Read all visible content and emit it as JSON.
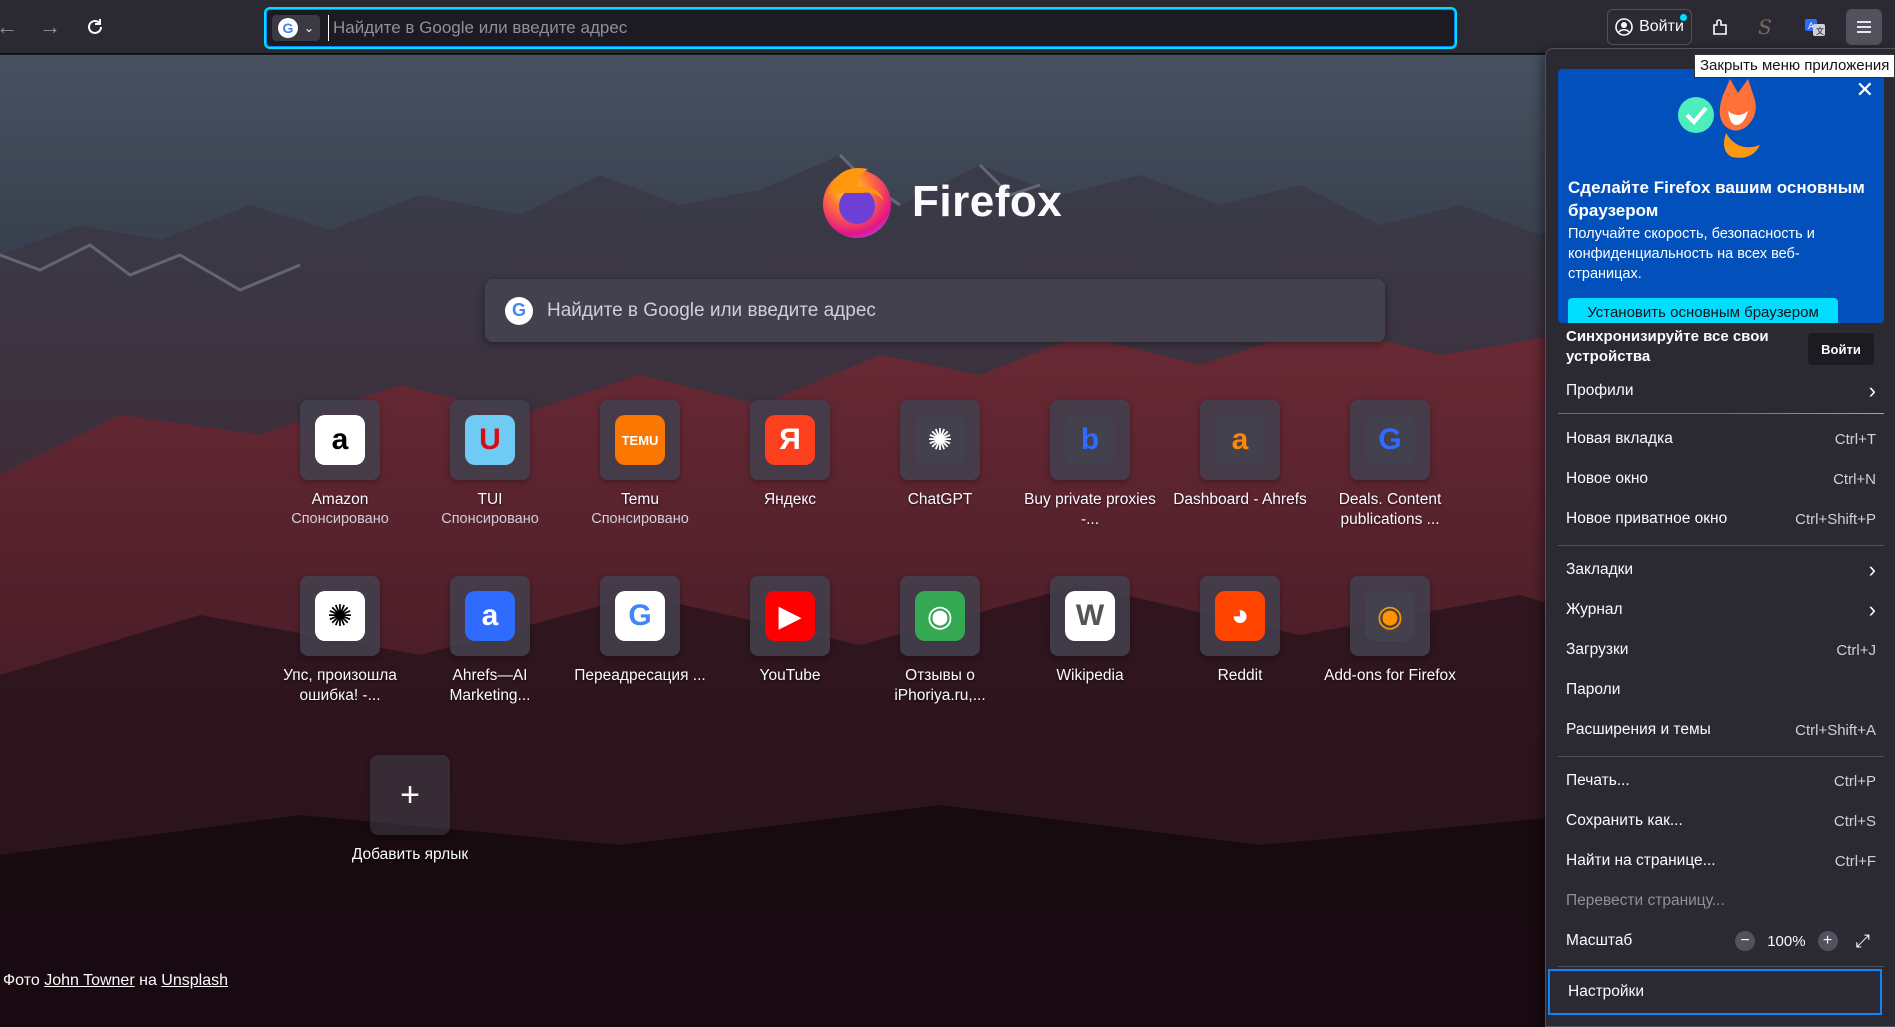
{
  "toolbar": {
    "back_icon": "back-arrow-icon",
    "forward_icon": "forward-arrow-icon",
    "reload_icon": "reload-icon",
    "url_placeholder": "Найдите в Google или введите адрес",
    "signin_label": "Войти",
    "tooltip": "Закрыть меню приложения"
  },
  "newtab": {
    "logo_text": "Firefox",
    "search_placeholder": "Найдите в Google или введите адрес",
    "shortcuts": [
      {
        "label": "Amazon",
        "sub": "Спонсировано",
        "icon": "amazon-icon",
        "bg": "#ffffff",
        "fg": "#000000",
        "glyph": "a"
      },
      {
        "label": "TUI",
        "sub": "Спонсировано",
        "icon": "tui-icon",
        "bg": "#70cbf4",
        "fg": "#d40e14",
        "glyph": "U"
      },
      {
        "label": "Temu",
        "sub": "Спонсировано",
        "icon": "temu-icon",
        "bg": "#fb7701",
        "fg": "#ffffff",
        "glyph": "TEMU"
      },
      {
        "label": "Яндекс",
        "sub": "",
        "icon": "yandex-icon",
        "bg": "#fc3f1d",
        "fg": "#ffffff",
        "glyph": "Я"
      },
      {
        "label": "ChatGPT",
        "sub": "",
        "icon": "chatgpt-icon",
        "bg": "#42414d",
        "fg": "#ffffff",
        "glyph": "✺"
      },
      {
        "label": "Buy private proxies -...",
        "sub": "",
        "icon": "proxy-icon",
        "bg": "#42414d",
        "fg": "#2f6bff",
        "glyph": "b"
      },
      {
        "label": "Dashboard - Ahrefs",
        "sub": "",
        "icon": "ahrefs-icon",
        "bg": "#42414d",
        "fg": "#ff8800",
        "glyph": "a"
      },
      {
        "label": "Deals. Content publications ...",
        "sub": "",
        "icon": "deals-icon",
        "bg": "#42414d",
        "fg": "#2f6bff",
        "glyph": "G"
      },
      {
        "label": "Упс, произошла ошибка! -...",
        "sub": "",
        "icon": "openai-icon",
        "bg": "#ffffff",
        "fg": "#000000",
        "glyph": "✺"
      },
      {
        "label": "Ahrefs—AI Marketing...",
        "sub": "",
        "icon": "ahrefs-ai-icon",
        "bg": "#2f6bff",
        "fg": "#ffffff",
        "glyph": "a"
      },
      {
        "label": "Переадресация ...",
        "sub": "",
        "icon": "google-icon",
        "bg": "#ffffff",
        "fg": "#4285f4",
        "glyph": "G"
      },
      {
        "label": "YouTube",
        "sub": "",
        "icon": "youtube-icon",
        "bg": "#ff0000",
        "fg": "#ffffff",
        "glyph": "▶"
      },
      {
        "label": "Отзывы о iPhoriya.ru,...",
        "sub": "",
        "icon": "maps-icon",
        "bg": "#34a853",
        "fg": "#ffffff",
        "glyph": "◉"
      },
      {
        "label": "Wikipedia",
        "sub": "",
        "icon": "wikipedia-icon",
        "bg": "#ffffff",
        "fg": "#555555",
        "glyph": "W"
      },
      {
        "label": "Reddit",
        "sub": "",
        "icon": "reddit-icon",
        "bg": "#ff4500",
        "fg": "#ffffff",
        "glyph": "◕"
      },
      {
        "label": "Add-ons for Firefox",
        "sub": "",
        "icon": "firefox-addons-icon",
        "bg": "#42414d",
        "fg": "#ff9400",
        "glyph": "◉"
      }
    ],
    "add_shortcut": "Добавить ярлык",
    "photo_prefix": "Фото",
    "photo_author": "John Towner",
    "photo_middle": "на",
    "photo_source": "Unsplash"
  },
  "menu": {
    "promo_title": "Сделайте Firefox вашим основным браузером",
    "promo_text": "Получайте скорость, безопасность и конфиденциальность на всех веб-страницах.",
    "promo_button": "Установить основным браузером",
    "sync_text": "Синхронизируйте все свои устройства",
    "sync_button": "Войти",
    "profiles": "Профили",
    "new_tab": "Новая вкладка",
    "new_tab_sc": "Ctrl+T",
    "new_window": "Новое окно",
    "new_window_sc": "Ctrl+N",
    "private_window": "Новое приватное окно",
    "private_window_sc": "Ctrl+Shift+P",
    "bookmarks": "Закладки",
    "history": "Журнал",
    "downloads": "Загрузки",
    "downloads_sc": "Ctrl+J",
    "passwords": "Пароли",
    "addons": "Расширения и темы",
    "addons_sc": "Ctrl+Shift+A",
    "print": "Печать...",
    "print_sc": "Ctrl+P",
    "save_as": "Сохранить как...",
    "save_as_sc": "Ctrl+S",
    "find": "Найти на странице...",
    "find_sc": "Ctrl+F",
    "translate": "Перевести страницу...",
    "zoom": "Масштаб",
    "zoom_value": "100%",
    "settings": "Настройки"
  }
}
